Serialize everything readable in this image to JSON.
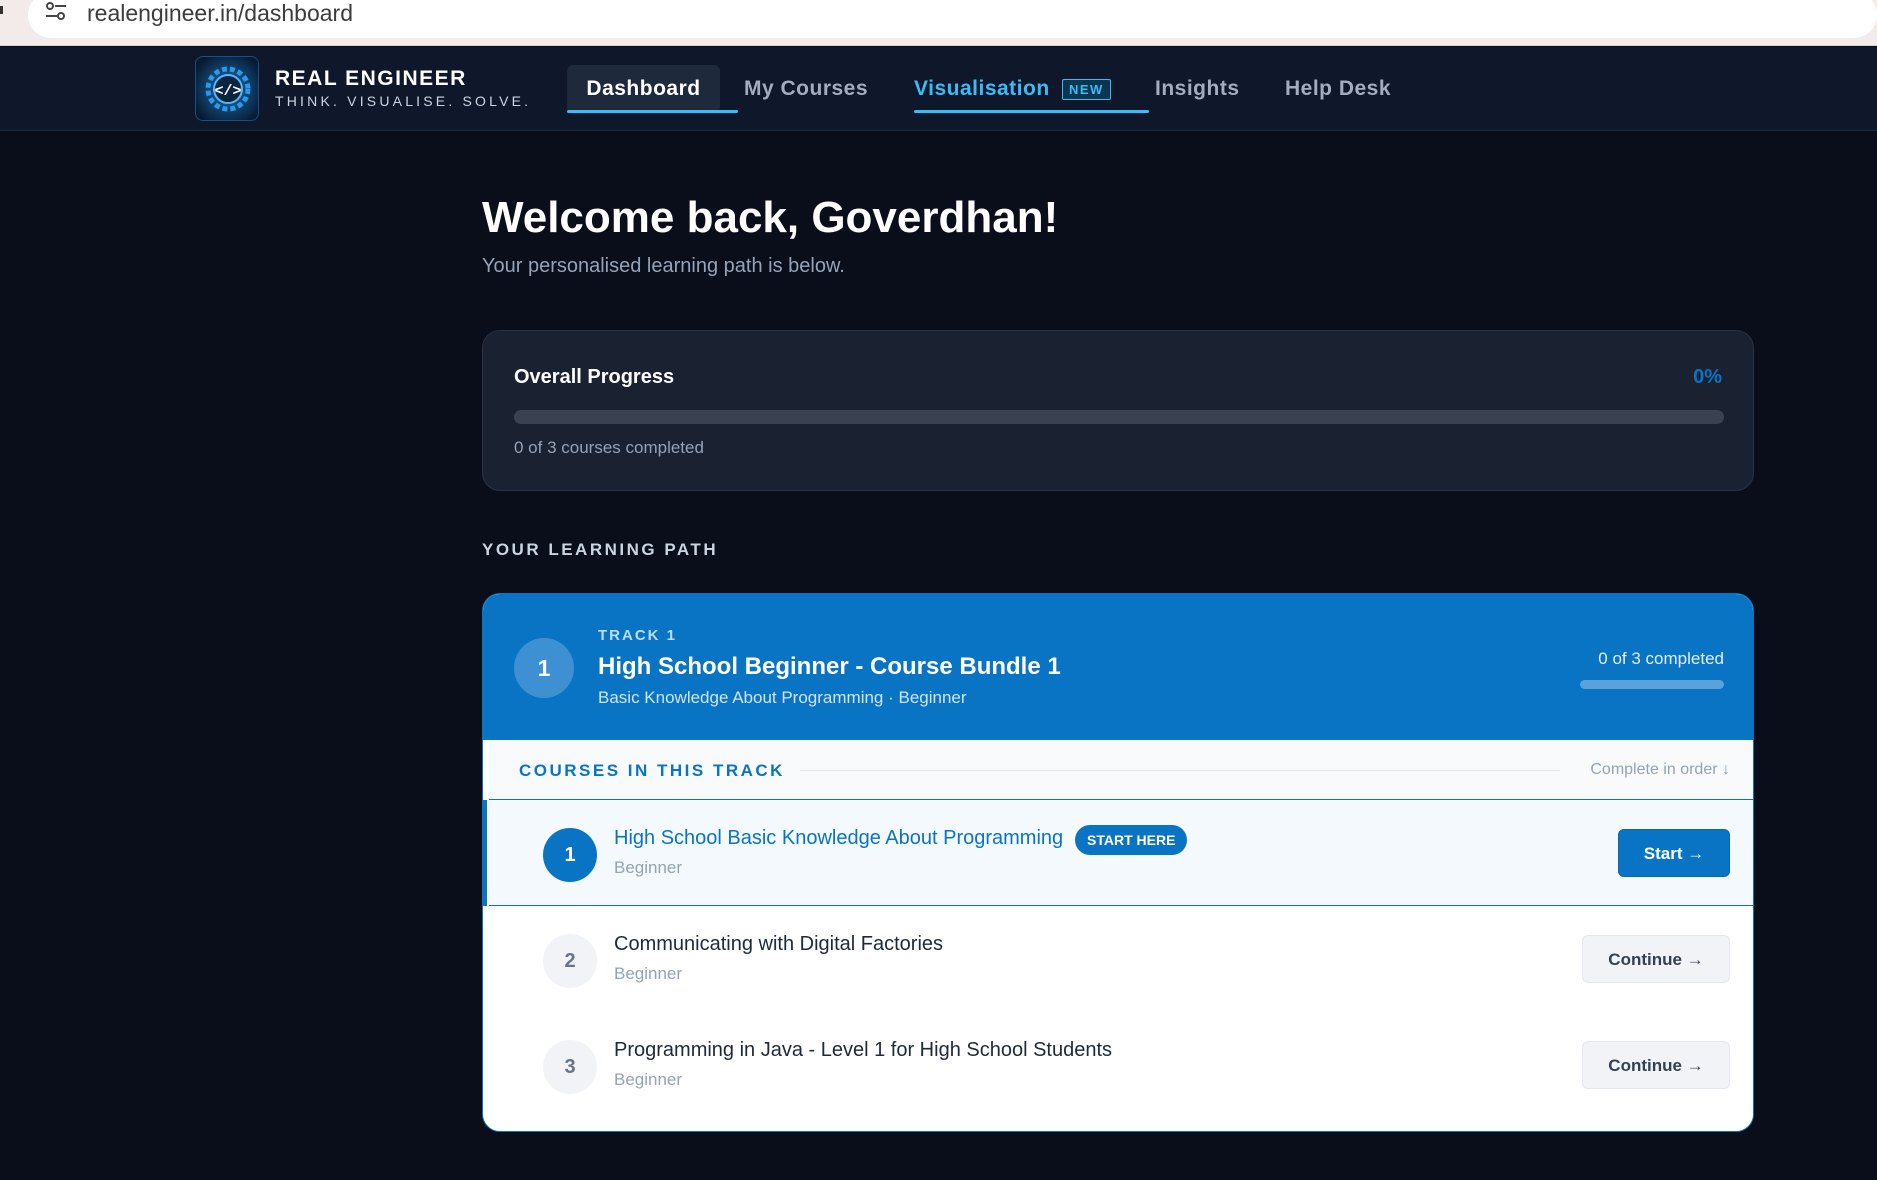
{
  "browser": {
    "url_display": "realengineer.in/dashboard",
    "site_info_icon": "tune-icon"
  },
  "brand": {
    "name": "REAL ENGINEER",
    "tagline": "THINK. VISUALISE. SOLVE.",
    "logo_icon": "gear-code-icon"
  },
  "nav": {
    "items": [
      {
        "label": "Dashboard",
        "active": true
      },
      {
        "label": "My Courses"
      },
      {
        "label": "Visualisation",
        "badge": "NEW",
        "highlight": true
      },
      {
        "label": "Insights"
      },
      {
        "label": "Help Desk"
      }
    ]
  },
  "main": {
    "welcome": "Welcome back, Goverdhan!",
    "subtitle": "Your personalised learning path is below."
  },
  "progress": {
    "title": "Overall Progress",
    "percent_text": "0%",
    "fraction": 0,
    "caption": "0 of 3 courses completed"
  },
  "learning_path": {
    "heading": "YOUR LEARNING PATH",
    "track": {
      "number": "1",
      "label": "TRACK 1",
      "title": "High School Beginner - Course Bundle 1",
      "meta": "Basic Knowledge About Programming · Beginner",
      "completed_text": "0 of 3 completed",
      "completed_fraction": 0,
      "courses_header": "COURSES IN THIS TRACK",
      "order_hint": "Complete in order ↓",
      "courses": [
        {
          "number": "1",
          "title": "High School Basic Knowledge About Programming",
          "badge": "START HERE",
          "level": "Beginner",
          "action": "Start →"
        },
        {
          "number": "2",
          "title": "Communicating with Digital Factories",
          "level": "Beginner",
          "action": "Continue →"
        },
        {
          "number": "3",
          "title": "Programming in Java - Level 1 for High School Students",
          "level": "Beginner",
          "action": "Continue →"
        }
      ]
    }
  },
  "colors": {
    "accent": "#0a74c4",
    "nav_highlight": "#38bdf8",
    "background": "#0a0e1a",
    "card": "#1a2130"
  }
}
